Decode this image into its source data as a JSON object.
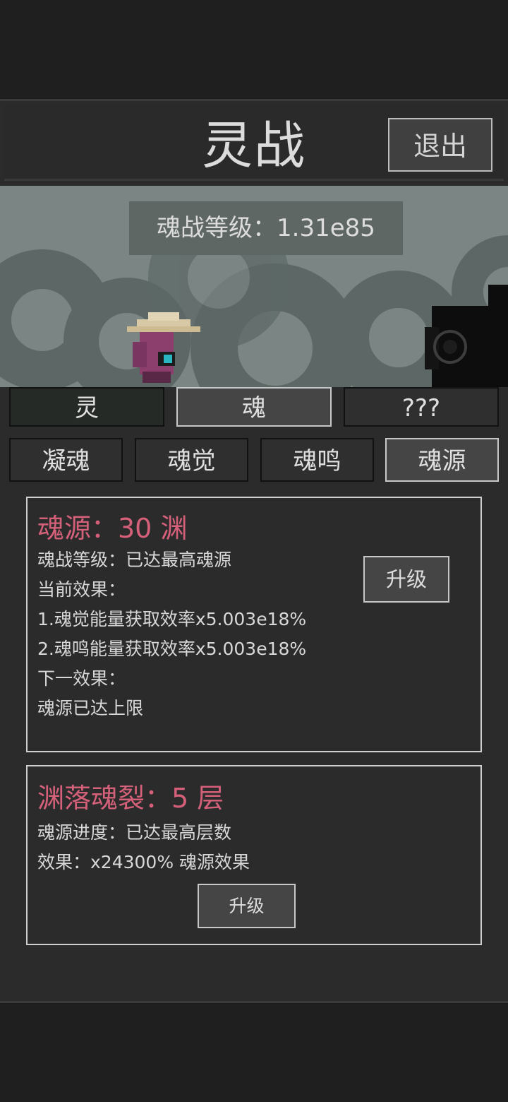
{
  "header": {
    "title": "灵战",
    "exit_label": "退出"
  },
  "scene": {
    "level_label": "魂战等级：1.31e85"
  },
  "tabs_row1": [
    "灵",
    "魂",
    "???"
  ],
  "tabs_row2": [
    "凝魂",
    "魂觉",
    "魂鸣",
    "魂源"
  ],
  "soul_source": {
    "title": "魂源：30 渊",
    "lines": [
      "魂战等级：已达最高魂源",
      "当前效果：",
      "1.魂觉能量获取效率x5.003e18%",
      "2.魂鸣能量获取效率x5.003e18%",
      "下一效果：",
      "魂源已达上限"
    ],
    "upgrade_label": "升级"
  },
  "abyss_fall": {
    "title": "渊落魂裂：5 层",
    "lines": [
      "魂源进度：已达最高层数",
      "效果：x24300% 魂源效果"
    ],
    "upgrade_label": "升级"
  },
  "colors": {
    "accent_pink": "#d4607a",
    "background": "#1f1f1f",
    "panel": "#2b2b2b"
  }
}
